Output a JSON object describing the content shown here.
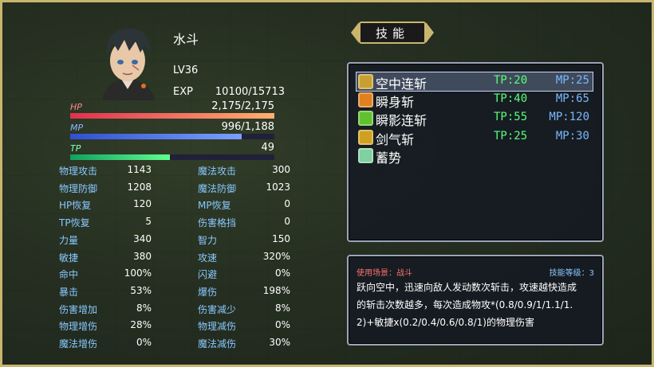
{
  "character": {
    "name": "水斗",
    "level": "LV36",
    "exp_label": "EXP",
    "exp_value": "10100/15713"
  },
  "gauges": {
    "hp": {
      "label": "HP",
      "value": "2,175/2,175",
      "fill": 1.0
    },
    "mp": {
      "label": "MP",
      "value": "996/1,188",
      "fill": 0.84
    },
    "tp": {
      "label": "TP",
      "value": "49",
      "fill": 0.49
    }
  },
  "stats_left": [
    {
      "k": "物理攻击",
      "v": "1143"
    },
    {
      "k": "物理防御",
      "v": "1208"
    },
    {
      "k": "HP恢复",
      "v": "120"
    },
    {
      "k": "TP恢复",
      "v": "5"
    },
    {
      "k": "力量",
      "v": "340"
    },
    {
      "k": "敏捷",
      "v": "380"
    },
    {
      "k": "命中",
      "v": "100%"
    },
    {
      "k": "暴击",
      "v": "53%"
    },
    {
      "k": "伤害增加",
      "v": "8%"
    },
    {
      "k": "物理增伤",
      "v": "28%"
    },
    {
      "k": "魔法增伤",
      "v": "0%"
    }
  ],
  "stats_right": [
    {
      "k": "魔法攻击",
      "v": "300"
    },
    {
      "k": "魔法防御",
      "v": "1023"
    },
    {
      "k": "MP恢复",
      "v": "0"
    },
    {
      "k": "伤害格挡",
      "v": "0"
    },
    {
      "k": "智力",
      "v": "150"
    },
    {
      "k": "攻速",
      "v": "320%"
    },
    {
      "k": "闪避",
      "v": "0%"
    },
    {
      "k": "爆伤",
      "v": "198%"
    },
    {
      "k": "伤害减少",
      "v": "8%"
    },
    {
      "k": "物理减伤",
      "v": "0%"
    },
    {
      "k": "魔法减伤",
      "v": "30%"
    }
  ],
  "skills_header": "技能",
  "skills": [
    {
      "name": "空中连斩",
      "tp": "TP:20",
      "mp": "MP:25",
      "icon": "sword-slash-icon",
      "color": "#c8a030",
      "selected": true
    },
    {
      "name": "瞬身斩",
      "tp": "TP:40",
      "mp": "MP:65",
      "icon": "dash-slash-icon",
      "color": "#e08020",
      "selected": false
    },
    {
      "name": "瞬影连斩",
      "tp": "TP:55",
      "mp": "MP:120",
      "icon": "shadow-slash-icon",
      "color": "#60c030",
      "selected": false
    },
    {
      "name": "剑气斩",
      "tp": "TP:25",
      "mp": "MP:30",
      "icon": "sword-wave-icon",
      "color": "#d0a020",
      "selected": false
    },
    {
      "name": "蓄势",
      "tp": "",
      "mp": "",
      "icon": "charge-icon",
      "color": "#80d0a0",
      "selected": false
    }
  ],
  "description": {
    "scene": "使用场景：战斗",
    "skill_level": "技能等级：3",
    "lines": [
      "跃向空中，迅速向敌人发动数次斩击，攻速越快造成",
      "的斩击次数越多，每次造成物攻*(0.8/0.9/1/1.1/1.",
      "2)+敏捷x(0.2/0.4/0.6/0.8/1)的物理伤害"
    ]
  }
}
